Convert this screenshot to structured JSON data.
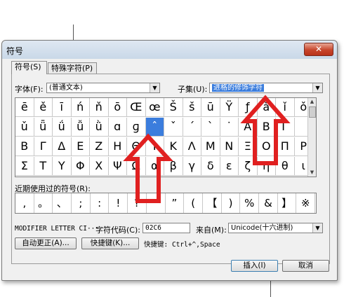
{
  "dialog": {
    "title": "符号",
    "close_label": "✕",
    "tabs": [
      {
        "label": "符号(S)"
      },
      {
        "label": "特殊字符(P)"
      }
    ],
    "font_label": "字体(F):",
    "font_value": "(普通文本)",
    "subset_label": "子集(U):",
    "subset_value": "进格的修饰字符",
    "recent_label": "近期使用过的符号(R):",
    "char_name": "MODIFIER LETTER CI···",
    "char_code_label": "字符代码(C):",
    "char_code_value": "02C6",
    "from_label": "来自(M):",
    "from_value": "Unicode(十六进制)",
    "autocorrect_button": "自动更正(A)...",
    "shortcut_button": "快捷键(K)...",
    "shortcut_text": "快捷键: Ctrl+^,Space",
    "insert_button": "插入(I)",
    "cancel_button": "取消"
  },
  "symbol_grid": [
    [
      "ē",
      "ě",
      "ī",
      "ń",
      "ň",
      "ō",
      "Œ",
      "œ",
      "Š",
      "š",
      "ū",
      "Ÿ",
      "ƒ",
      "ǎ",
      "ǐ",
      "ǒ"
    ],
    [
      "ǔ",
      "ǖ",
      "ǘ",
      "ǚ",
      "ǜ",
      "ɑ",
      "ɡ",
      "ˆ",
      "ˇ",
      "ˊ",
      "ˋ",
      "˙",
      "Α",
      "Β",
      "Γ",
      ""
    ],
    [
      "Β",
      "Γ",
      "Δ",
      "Ε",
      "Ζ",
      "Η",
      "Θ",
      "Ι",
      "Κ",
      "Λ",
      "Μ",
      "Ν",
      "Ξ",
      "Ο",
      "Π",
      "Ρ"
    ],
    [
      "Σ",
      "Τ",
      "Υ",
      "Φ",
      "Χ",
      "Ψ",
      "Ω",
      "α",
      "β",
      "γ",
      "δ",
      "ε",
      "ζ",
      "η",
      "θ",
      "ι"
    ]
  ],
  "selected_cell": {
    "row": 1,
    "col": 7
  },
  "recent_symbols": [
    ",",
    "。",
    "、",
    ";",
    ":",
    "!",
    "?",
    "“",
    "”",
    "(",
    "【",
    ")",
    "%",
    "&",
    "】",
    "※"
  ],
  "colors": {
    "accent": "#3b7ddd",
    "arrow": "#e02020"
  }
}
